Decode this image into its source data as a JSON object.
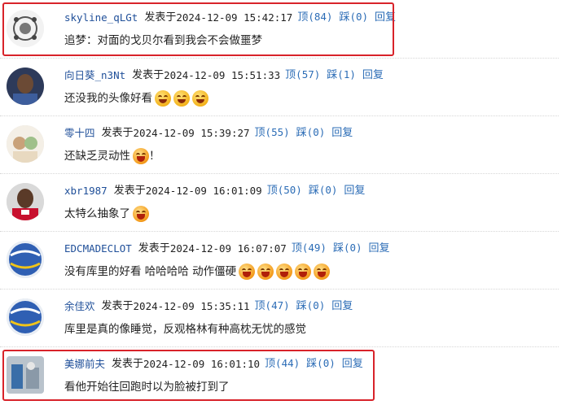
{
  "posted_label": "发表于",
  "up_label": "顶",
  "down_label": "踩",
  "reply_label": "回复",
  "comments": [
    {
      "username": "skyline_qLGt",
      "timestamp": "2024-12-09 15:42:17",
      "up": "(84)",
      "down": "(0)",
      "text": "追梦：对面的戈贝尔看到我会不会做噩梦",
      "emojis": [],
      "highlighted": true,
      "avatar": "emblem-avatar"
    },
    {
      "username": "向日葵_n3Nt",
      "timestamp": "2024-12-09 15:51:33",
      "up": "(57)",
      "down": "(1)",
      "text": "还没我的头像好看",
      "emojis": [
        "smile",
        "smile",
        "smile"
      ],
      "trailing": "",
      "highlighted": false,
      "avatar": "player-avatar"
    },
    {
      "username": "零十四",
      "timestamp": "2024-12-09 15:39:27",
      "up": "(55)",
      "down": "(0)",
      "text": "还缺乏灵动性",
      "emojis": [
        "laugh"
      ],
      "trailing": "！",
      "highlighted": false,
      "avatar": "cartoon-avatar"
    },
    {
      "username": "xbr1987",
      "timestamp": "2024-12-09 16:01:09",
      "up": "(50)",
      "down": "(0)",
      "text": "太特么抽象了",
      "emojis": [
        "laugh"
      ],
      "trailing": "",
      "highlighted": false,
      "avatar": "player-avatar"
    },
    {
      "username": "EDCMADECLOT",
      "timestamp": "2024-12-09 16:07:07",
      "up": "(49)",
      "down": "(0)",
      "text": "没有库里的好看 哈哈哈哈 动作僵硬",
      "emojis": [
        "laugh",
        "laugh",
        "laugh",
        "laugh",
        "laugh"
      ],
      "trailing": "",
      "highlighted": false,
      "avatar": "basketball-avatar"
    },
    {
      "username": "余佳欢",
      "timestamp": "2024-12-09 15:35:11",
      "up": "(47)",
      "down": "(0)",
      "text": "库里是真的像睡觉，反观格林有种高枕无忧的感觉",
      "emojis": [],
      "trailing": "",
      "highlighted": false,
      "avatar": "basketball-avatar"
    },
    {
      "username": "美娜前夫",
      "timestamp": "2024-12-09 16:01:10",
      "up": "(44)",
      "down": "(0)",
      "text": "看他开始往回跑时以为脸被打到了",
      "emojis": [],
      "trailing": "",
      "highlighted": true,
      "avatar": "photo-avatar"
    }
  ],
  "colors": {
    "link": "#2b6cb6",
    "username": "#1f4f99",
    "highlight": "#d8232a"
  }
}
